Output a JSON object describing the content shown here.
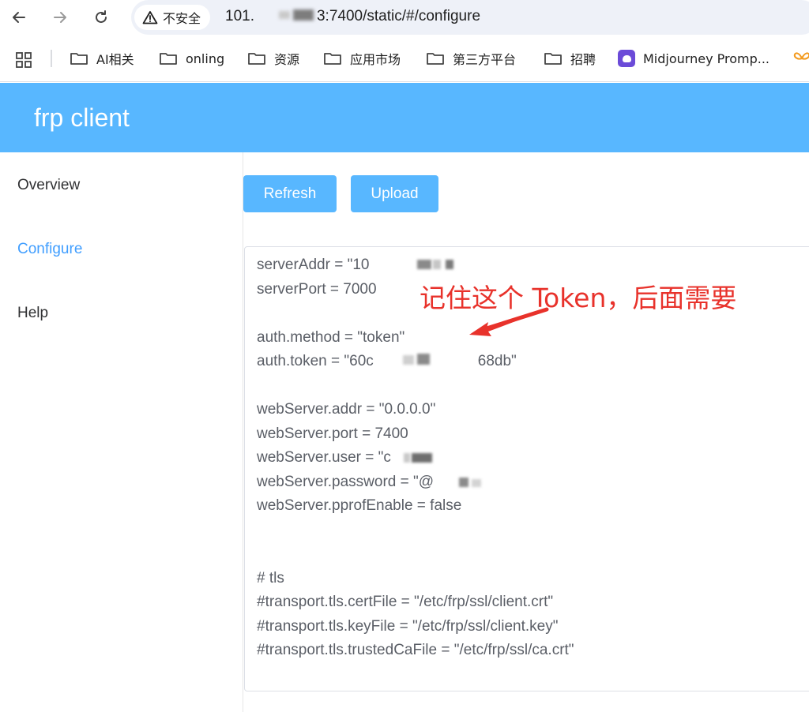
{
  "browser": {
    "security_label": "不安全",
    "url_prefix": "101.",
    "url_suffix": "3:7400/static/#/configure",
    "bookmarks": [
      {
        "label": "AI相关",
        "icon": "folder-icon"
      },
      {
        "label": "onling",
        "icon": "folder-icon"
      },
      {
        "label": "资源",
        "icon": "folder-icon"
      },
      {
        "label": "应用市场",
        "icon": "folder-icon"
      },
      {
        "label": "第三方平台",
        "icon": "folder-icon"
      },
      {
        "label": "招聘",
        "icon": "folder-icon"
      },
      {
        "label": "Midjourney Promp...",
        "icon": "midjourney-favicon"
      }
    ]
  },
  "app": {
    "title": "frp client",
    "sidebar": [
      {
        "label": "Overview",
        "active": false
      },
      {
        "label": "Configure",
        "active": true
      },
      {
        "label": "Help",
        "active": false
      }
    ],
    "buttons": {
      "refresh": "Refresh",
      "upload": "Upload"
    },
    "config_lines": [
      "serverAddr = \"10             3\"",
      "serverPort = 7000",
      "",
      "auth.method = \"token\"",
      "auth.token = \"60c                   e6168db\"",
      "",
      "webServer.addr = \"0.0.0.0\"",
      "webServer.port = 7400",
      "webServer.user = \"c        g\"",
      "webServer.password = \"@              q\"",
      "webServer.pprofEnable = false",
      "",
      "",
      "# tls",
      "#transport.tls.certFile = \"/etc/frp/ssl/client.crt\"",
      "#transport.tls.keyFile = \"/etc/frp/ssl/client.key\"",
      "#transport.tls.trustedCaFile = \"/etc/frp/ssl/ca.crt\""
    ]
  },
  "annotation": {
    "text": "记住这个 Token，后面需要",
    "color": "#e8322b"
  },
  "colors": {
    "header": "#58b7ff",
    "active_nav": "#409eff",
    "button": "#58b7ff"
  }
}
